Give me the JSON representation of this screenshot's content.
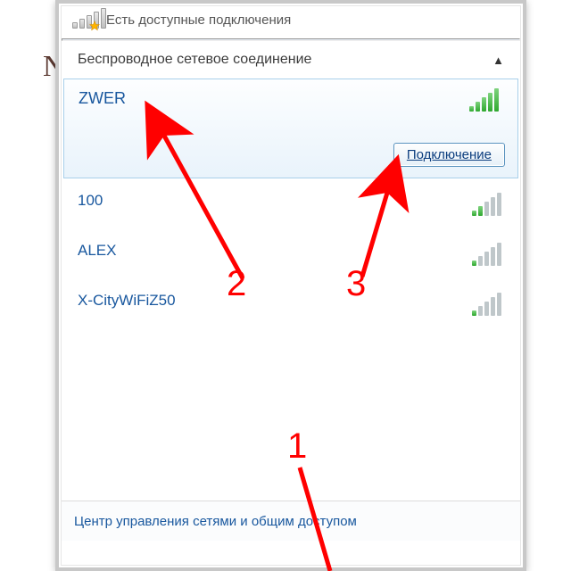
{
  "header": {
    "status_text": "Есть доступные подключения"
  },
  "section": {
    "title": "Беспроводное сетевое соединение"
  },
  "networks": [
    {
      "ssid": "ZWER",
      "bars_filled": 5,
      "selected": true
    },
    {
      "ssid": "100",
      "bars_filled": 2,
      "selected": false
    },
    {
      "ssid": "ALEX",
      "bars_filled": 1,
      "selected": false
    },
    {
      "ssid": "X-CityWiFiZ50",
      "bars_filled": 1,
      "selected": false
    }
  ],
  "connect_button": "Подключение",
  "footer": {
    "link_text": "Центр управления сетями и общим доступом"
  },
  "annotations": {
    "n1": "1",
    "n2": "2",
    "n3": "3"
  },
  "colors": {
    "accent": "#ff0000",
    "link": "#18579e"
  }
}
